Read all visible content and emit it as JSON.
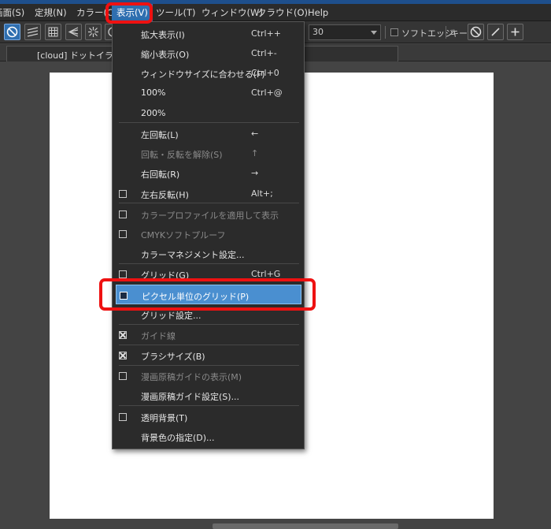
{
  "menubar": {
    "items": [
      "画面(S)",
      "定規(N)",
      "カラー(C)",
      "表示(V)",
      "ツール(T)",
      "ウィンドウ(W)",
      "クラウド(O)",
      "Help"
    ]
  },
  "toolbar": {
    "size_value": "30",
    "soft_edge_label": "ソフトエッジ",
    "key_label": "キー"
  },
  "tab": {
    "title": "[cloud] ドットイラスト"
  },
  "view_menu": {
    "items": [
      {
        "label": "拡大表示(I)",
        "shortcut": "Ctrl++",
        "enabled": true
      },
      {
        "label": "縮小表示(O)",
        "shortcut": "Ctrl+-",
        "enabled": true
      },
      {
        "label": "ウィンドウサイズに合わせる(F)",
        "shortcut": "Ctrl+0",
        "enabled": true
      },
      {
        "label": "100%",
        "shortcut": "Ctrl+@",
        "enabled": true
      },
      {
        "label": "200%",
        "shortcut": "",
        "enabled": true
      },
      {
        "label": "左回転(L)",
        "shortcut": "←",
        "enabled": true
      },
      {
        "label": "回転・反転を解除(S)",
        "shortcut": "↑",
        "enabled": false
      },
      {
        "label": "右回転(R)",
        "shortcut": "→",
        "enabled": true
      },
      {
        "label": "左右反転(H)",
        "shortcut": "Alt+;",
        "enabled": true,
        "checkbox": true,
        "checked": false
      },
      {
        "label": "カラープロファイルを適用して表示",
        "shortcut": "",
        "enabled": false,
        "checkbox": true,
        "checked": false
      },
      {
        "label": "CMYKソフトプルーフ",
        "shortcut": "",
        "enabled": false,
        "checkbox": true,
        "checked": false
      },
      {
        "label": "カラーマネジメント設定...",
        "shortcut": "",
        "enabled": true
      },
      {
        "label": "グリッド(G)",
        "shortcut": "Ctrl+G",
        "enabled": true,
        "checkbox": true,
        "checked": false
      },
      {
        "label": "ピクセル単位のグリッド(P)",
        "shortcut": "",
        "enabled": true,
        "checkbox": true,
        "checked": false,
        "highlighted": true
      },
      {
        "label": "グリッド設定...",
        "shortcut": "",
        "enabled": true
      },
      {
        "label": "ガイド線",
        "shortcut": "",
        "enabled": false,
        "checkbox": true,
        "checked": true
      },
      {
        "label": "ブラシサイズ(B)",
        "shortcut": "",
        "enabled": true,
        "checkbox": true,
        "checked": true
      },
      {
        "label": "漫画原稿ガイドの表示(M)",
        "shortcut": "",
        "enabled": false,
        "checkbox": true,
        "checked": false
      },
      {
        "label": "漫画原稿ガイド設定(S)...",
        "shortcut": "",
        "enabled": true
      },
      {
        "label": "透明背景(T)",
        "shortcut": "",
        "enabled": true,
        "checkbox": true,
        "checked": false
      },
      {
        "label": "背景色の指定(D)...",
        "shortcut": "",
        "enabled": true
      }
    ]
  },
  "colors": {
    "menu_active": "#2f6fb0",
    "highlight_row": "#4a8fd0",
    "annotation_red": "#ee1111"
  }
}
